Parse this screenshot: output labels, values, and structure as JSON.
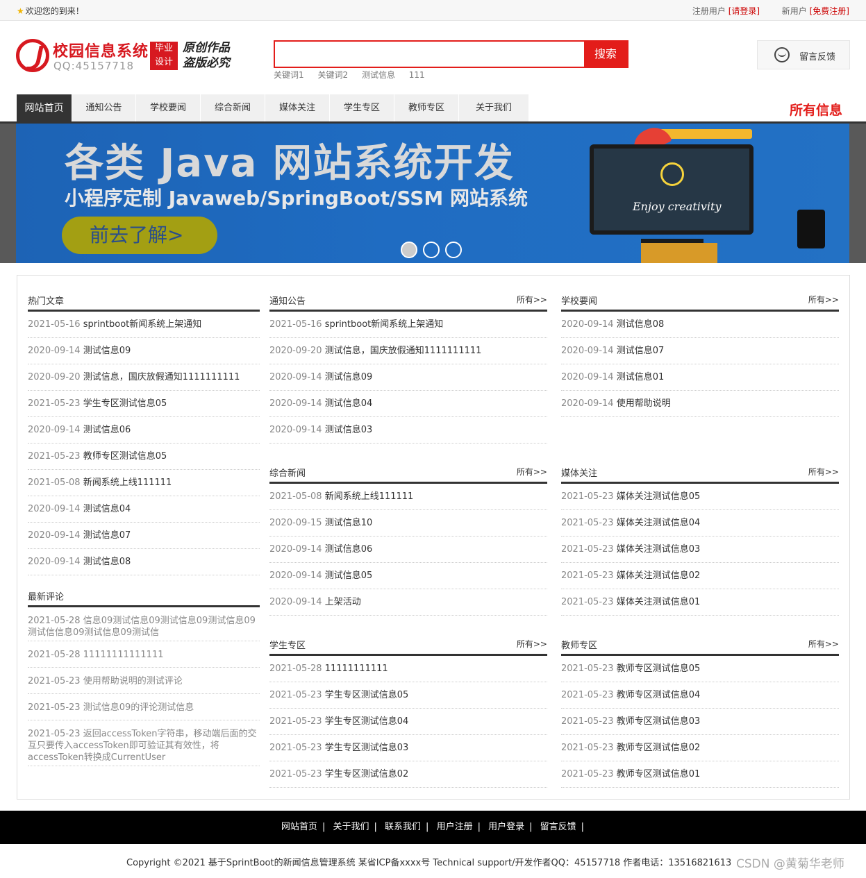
{
  "topbar": {
    "welcome": "欢迎您的到来！",
    "reg_prefix": "注册用户",
    "login_link": "[请登录]",
    "new_prefix": "新用户",
    "register_link": "[免费注册]"
  },
  "header": {
    "site_title": "校园信息系统",
    "qq": "QQ:45157718",
    "badge_line1": "毕业",
    "badge_line2": "设计",
    "slogan_line1": "原创作品",
    "slogan_line2": "盗版必究",
    "search_value": "",
    "search_button": "搜索",
    "keywords": [
      "关键词1",
      "关键词2",
      "测试信息",
      "111"
    ],
    "feedback": "留言反馈"
  },
  "nav": {
    "items": [
      "网站首页",
      "通知公告",
      "学校要闻",
      "综合新闻",
      "媒体关注",
      "学生专区",
      "教师专区",
      "关于我们"
    ],
    "all_info": "所有信息"
  },
  "banner": {
    "headline": "各类 Java 网站系统开发",
    "subline": "小程序定制  Javaweb/SpringBoot/SSM 网站系统",
    "cta": "前去了解>",
    "enjoy": "Enjoy creativity"
  },
  "more_label": "所有>>",
  "sections": {
    "hot": {
      "title": "热门文章",
      "items": [
        {
          "date": "2021-05-16",
          "title": "sprintboot新闻系统上架通知"
        },
        {
          "date": "2020-09-14",
          "title": "测试信息09"
        },
        {
          "date": "2020-09-20",
          "title": "测试信息，国庆放假通知1111111111"
        },
        {
          "date": "2021-05-23",
          "title": "学生专区测试信息05"
        },
        {
          "date": "2020-09-14",
          "title": "测试信息06"
        },
        {
          "date": "2021-05-23",
          "title": "教师专区测试信息05"
        },
        {
          "date": "2021-05-08",
          "title": "新闻系统上线111111"
        },
        {
          "date": "2020-09-14",
          "title": "测试信息04"
        },
        {
          "date": "2020-09-14",
          "title": "测试信息07"
        },
        {
          "date": "2020-09-14",
          "title": "测试信息08"
        }
      ]
    },
    "comments": {
      "title": "最新评论",
      "items": [
        {
          "date": "2021-05-28",
          "title": "信息09测试信息09测试信息09测试信息09测试信信息09测试信息09测试信"
        },
        {
          "date": "2021-05-28",
          "title": "11111111111111"
        },
        {
          "date": "2021-05-23",
          "title": "使用帮助说明的测试评论"
        },
        {
          "date": "2021-05-23",
          "title": "测试信息09的评论测试信息"
        },
        {
          "date": "2021-05-23",
          "title": "返回accessToken字符串，移动端后面的交互只要传入accessToken即可验证其有效性，将accessToken转换成CurrentUser"
        }
      ]
    },
    "notice": {
      "title": "通知公告",
      "items": [
        {
          "date": "2021-05-16",
          "title": "sprintboot新闻系统上架通知"
        },
        {
          "date": "2020-09-20",
          "title": "测试信息，国庆放假通知1111111111"
        },
        {
          "date": "2020-09-14",
          "title": "测试信息09"
        },
        {
          "date": "2020-09-14",
          "title": "测试信息04"
        },
        {
          "date": "2020-09-14",
          "title": "测试信息03"
        }
      ]
    },
    "school": {
      "title": "学校要闻",
      "items": [
        {
          "date": "2020-09-14",
          "title": "测试信息08"
        },
        {
          "date": "2020-09-14",
          "title": "测试信息07"
        },
        {
          "date": "2020-09-14",
          "title": "测试信息01"
        },
        {
          "date": "2020-09-14",
          "title": "使用帮助说明"
        }
      ]
    },
    "news": {
      "title": "综合新闻",
      "items": [
        {
          "date": "2021-05-08",
          "title": "新闻系统上线111111"
        },
        {
          "date": "2020-09-15",
          "title": "测试信息10"
        },
        {
          "date": "2020-09-14",
          "title": "测试信息06"
        },
        {
          "date": "2020-09-14",
          "title": "测试信息05"
        },
        {
          "date": "2020-09-14",
          "title": "上架活动"
        }
      ]
    },
    "media": {
      "title": "媒体关注",
      "items": [
        {
          "date": "2021-05-23",
          "title": "媒体关注测试信息05"
        },
        {
          "date": "2021-05-23",
          "title": "媒体关注测试信息04"
        },
        {
          "date": "2021-05-23",
          "title": "媒体关注测试信息03"
        },
        {
          "date": "2021-05-23",
          "title": "媒体关注测试信息02"
        },
        {
          "date": "2021-05-23",
          "title": "媒体关注测试信息01"
        }
      ]
    },
    "student": {
      "title": "学生专区",
      "items": [
        {
          "date": "2021-05-28",
          "title": "11111111111"
        },
        {
          "date": "2021-05-23",
          "title": "学生专区测试信息05"
        },
        {
          "date": "2021-05-23",
          "title": "学生专区测试信息04"
        },
        {
          "date": "2021-05-23",
          "title": "学生专区测试信息03"
        },
        {
          "date": "2021-05-23",
          "title": "学生专区测试信息02"
        }
      ]
    },
    "teacher": {
      "title": "教师专区",
      "items": [
        {
          "date": "2021-05-23",
          "title": "教师专区测试信息05"
        },
        {
          "date": "2021-05-23",
          "title": "教师专区测试信息04"
        },
        {
          "date": "2021-05-23",
          "title": "教师专区测试信息03"
        },
        {
          "date": "2021-05-23",
          "title": "教师专区测试信息02"
        },
        {
          "date": "2021-05-23",
          "title": "教师专区测试信息01"
        }
      ]
    }
  },
  "footer": {
    "links": [
      "网站首页",
      "关于我们",
      "联系我们",
      "用户注册",
      "用户登录",
      "留言反馈"
    ],
    "sep": "|",
    "copyright": "Copyright ©2021 基于SprintBoot的新闻信息管理系统    某省ICP备xxxx号    Technical support/开发作者QQ：45157718    作者电话：13516821613",
    "watermark": "CSDN @黄菊华老师"
  },
  "colors": {
    "brand_red": "#e31d1a",
    "dark": "#333333",
    "banner_blue": "#1f6cc2"
  }
}
